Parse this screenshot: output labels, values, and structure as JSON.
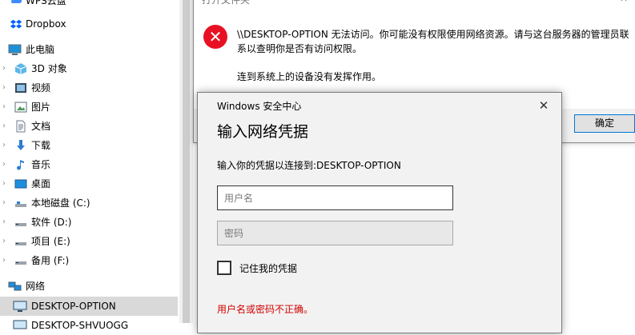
{
  "nav": {
    "items": [
      {
        "label": "WPS云盘",
        "icon": "cloud-icon"
      },
      {
        "label": "Dropbox",
        "icon": "dropbox-icon"
      },
      {
        "label": "此电脑",
        "icon": "computer-icon"
      },
      {
        "label": "3D 对象",
        "icon": "3d-objects-icon"
      },
      {
        "label": "视频",
        "icon": "videos-icon"
      },
      {
        "label": "图片",
        "icon": "pictures-icon"
      },
      {
        "label": "文档",
        "icon": "documents-icon"
      },
      {
        "label": "下载",
        "icon": "downloads-icon"
      },
      {
        "label": "音乐",
        "icon": "music-icon"
      },
      {
        "label": "桌面",
        "icon": "desktop-icon"
      },
      {
        "label": "本地磁盘 (C:)",
        "icon": "drive-icon"
      },
      {
        "label": "软件 (D:)",
        "icon": "drive-icon"
      },
      {
        "label": "项目 (E:)",
        "icon": "drive-icon"
      },
      {
        "label": "备用 (F:)",
        "icon": "drive-icon"
      },
      {
        "label": "网络",
        "icon": "network-icon"
      },
      {
        "label": "DESKTOP-OPTION",
        "icon": "monitor-icon"
      },
      {
        "label": "DESKTOP-SHVUOGG",
        "icon": "monitor-icon"
      }
    ]
  },
  "error_dialog": {
    "title": "打开文件夹",
    "close_glyph": "✕",
    "icon_glyph": "✕",
    "message": "\\\\DESKTOP-OPTION 无法访问。你可能没有权限使用网络资源。请与这台服务器的管理员联系以查明你是否有访问权限。",
    "detail": "连到系统上的设备没有发挥作用。",
    "ok_label": "确定"
  },
  "cred_dialog": {
    "app_name": "Windows 安全中心",
    "close_glyph": "✕",
    "heading": "输入网络凭据",
    "prompt": "输入你的凭据以连接到:DESKTOP-OPTION",
    "username_placeholder": "用户名",
    "password_placeholder": "密码",
    "remember_label": "记住我的凭据",
    "error_text": "用户名或密码不正确。"
  },
  "colors": {
    "error_red": "#e81123",
    "error_text": "#d20000",
    "accent_blue": "#0078d7",
    "selection_gray": "#d9d9d9"
  }
}
